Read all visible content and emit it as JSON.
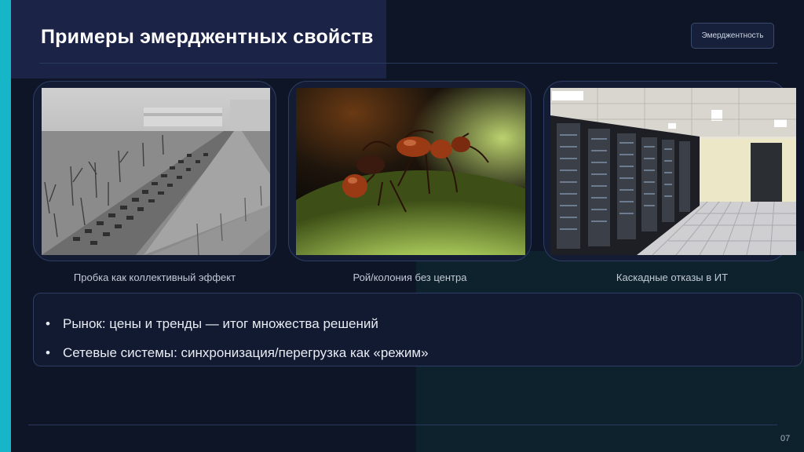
{
  "slide": {
    "title": "Примеры эмерджентных свойств",
    "tag": "Эмерджентность",
    "page_number": "07"
  },
  "cards": [
    {
      "caption": "Пробка как коллективный эффект",
      "image": "traffic-jam-photo"
    },
    {
      "caption": "Рой/колония без центра",
      "image": "ants-photo"
    },
    {
      "caption": "Каскадные отказы в ИТ",
      "image": "server-room-photo"
    }
  ],
  "bullets": [
    "Рынок: цены и тренды — итог множества решений",
    "Сетевые системы: синхронизация/перегрузка как «режим»"
  ],
  "colors": {
    "accent": "#16b5c8",
    "background": "#0e1526",
    "panel": "#1b2347"
  }
}
